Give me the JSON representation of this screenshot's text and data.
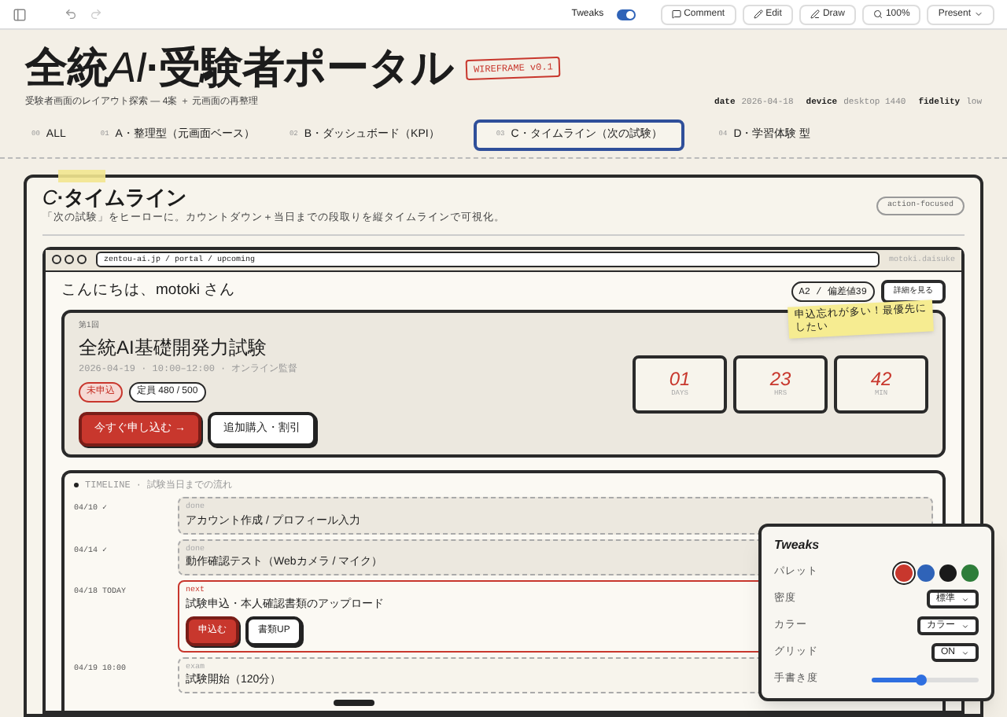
{
  "toolbar": {
    "tweaks_label": "Tweaks",
    "tweaks_on": true,
    "buttons": [
      {
        "kind": "comment",
        "label": "Comment"
      },
      {
        "kind": "edit",
        "label": "Edit"
      },
      {
        "kind": "draw",
        "label": "Draw"
      },
      {
        "kind": "zoom",
        "label": "100%"
      },
      {
        "kind": "present",
        "label": "Present"
      }
    ]
  },
  "header": {
    "title": [
      {
        "text": "全統",
        "italic": false
      },
      {
        "text": "AI",
        "italic": true
      },
      {
        "text": "·受験者ポータル",
        "italic": false
      }
    ],
    "badge": "WIREFRAME v0.1",
    "subtitle": "受験者画面のレイアウト探索 — 4案 ＋ 元画面の再整理",
    "meta": [
      {
        "key": "date",
        "value": "2026-04-18"
      },
      {
        "key": "device",
        "value": "desktop 1440"
      },
      {
        "key": "fidelity",
        "value": "low"
      }
    ]
  },
  "tabs": [
    {
      "num": "00",
      "label": "ALL",
      "selected": false
    },
    {
      "num": "01",
      "label": "A・整理型（元画面ベース）",
      "selected": false
    },
    {
      "num": "02",
      "label": "B・ダッシュボード（KPI）",
      "selected": false
    },
    {
      "num": "03",
      "label": "C・タイムライン（次の試験）",
      "selected": true
    },
    {
      "num": "04",
      "label": "D・学習体験 型",
      "selected": false
    }
  ],
  "section": {
    "title": [
      {
        "text": "C",
        "italic": true
      },
      {
        "text": "·タイムライン",
        "italic": false
      }
    ],
    "description": "「次の試験」をヒーローに。カウントダウン＋当日までの段取りを縦タイムラインで可視化。",
    "tag": "action-focused"
  },
  "browser": {
    "url": "zentou-ai.jp / portal / upcoming",
    "user": "motoki.daisuke",
    "greeting": "こんにちは、motoki さん",
    "chip": "A2 / 偏差値39",
    "detail_button": "詳細を見る"
  },
  "hero": {
    "round": "第1回",
    "title": "全統AI基礎開発力試験",
    "meta": "2026-04-19 · 10:00–12:00 · オンライン監督",
    "badges": [
      {
        "kind": "alert",
        "label": "未申込"
      },
      {
        "kind": "plain",
        "label": "定員 480 / 500"
      }
    ],
    "buttons": [
      {
        "kind": "primary",
        "label": "今すぐ申し込む →"
      },
      {
        "kind": "secondary",
        "label": "追加購入・割引"
      }
    ],
    "countdown": [
      {
        "value": "01",
        "unit": "DAYS"
      },
      {
        "value": "23",
        "unit": "HRS"
      },
      {
        "value": "42",
        "unit": "MIN"
      }
    ],
    "note": "申込忘れが多い！最優先にしたい"
  },
  "timeline": {
    "heading": "TIMELINE · 試験当日までの流れ",
    "items": [
      {
        "date": "04/10 ✓",
        "status": "done",
        "title": "アカウント作成 / プロフィール入力",
        "kind": "done"
      },
      {
        "date": "04/14 ✓",
        "status": "done",
        "title": "動作確認テスト（Webカメラ / マイク）",
        "kind": "done"
      },
      {
        "date": "04/18 TODAY",
        "status": "next",
        "title": "試験申込・本人確認書類のアップロード",
        "kind": "next",
        "buttons": [
          {
            "kind": "primary",
            "label": "申込む"
          },
          {
            "kind": "secondary",
            "label": "書類UP"
          }
        ]
      },
      {
        "date": "04/19 10:00",
        "status": "exam",
        "title": "試験開始（120分）",
        "kind": "exam"
      }
    ]
  },
  "tweaks": {
    "title": "Tweaks",
    "rows": [
      {
        "kind": "palette",
        "label": "パレット",
        "colors": [
          {
            "color": "#c8372d",
            "selected": true
          },
          {
            "color": "#2f63b8",
            "selected": false
          },
          {
            "color": "#1a1a1a",
            "selected": false
          },
          {
            "color": "#2e7d3a",
            "selected": false
          }
        ]
      },
      {
        "kind": "select",
        "label": "密度",
        "value": "標準"
      },
      {
        "kind": "select",
        "label": "カラー",
        "value": "カラー"
      },
      {
        "kind": "select",
        "label": "グリッド",
        "value": "ON"
      },
      {
        "kind": "slider",
        "label": "手書き度",
        "level": 0.45
      }
    ]
  }
}
